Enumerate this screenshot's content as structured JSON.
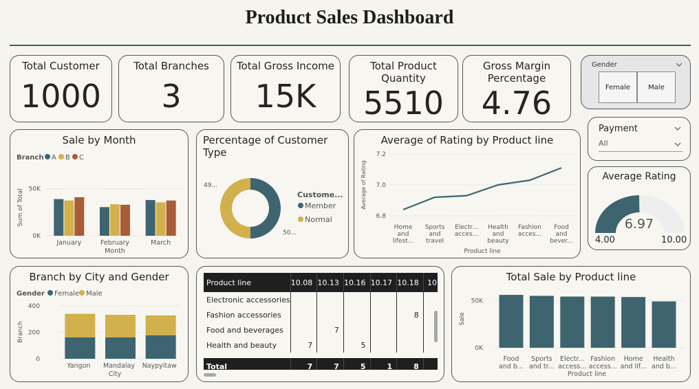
{
  "dashboard": {
    "title": "Product Sales Dashboard"
  },
  "kpis": [
    {
      "label": "Total Customer",
      "value": "1000"
    },
    {
      "label": "Total Branches",
      "value": "3"
    },
    {
      "label": "Total Gross Income",
      "value": "15K"
    },
    {
      "label": "Total Product Quantity",
      "value": "5510"
    },
    {
      "label": "Gross Margin Percentage",
      "value": "4.76"
    }
  ],
  "gender_slicer": {
    "title": "Gender",
    "options": [
      "Female",
      "Male"
    ],
    "chevron_icon": "chevron-down-icon"
  },
  "payment_slicer": {
    "title": "Payment",
    "value": "All",
    "chevron_icon": "chevron-down-icon"
  },
  "avg_rating": {
    "title": "Average Rating",
    "value": "6.97",
    "min": "4.00",
    "max": "10.00"
  },
  "colors": {
    "teal": "#3e6470",
    "gold": "#d2b04c",
    "rust": "#a95c38",
    "track": "#eeeeee"
  },
  "chart_data": [
    {
      "id": "sale_by_month",
      "type": "bar",
      "title": "Sale by Month",
      "legend_title": "Branch",
      "categories": [
        "January",
        "February",
        "March"
      ],
      "series": [
        {
          "name": "A",
          "values": [
            39000,
            30500,
            38000
          ]
        },
        {
          "name": "B",
          "values": [
            37500,
            33500,
            35500
          ]
        },
        {
          "name": "C",
          "values": [
            41000,
            33000,
            37500
          ]
        }
      ],
      "xlabel": "Month",
      "ylabel": "Sum of Total",
      "yticks": [
        "0K",
        "50K"
      ],
      "ylim": [
        0,
        60000
      ]
    },
    {
      "id": "customer_type",
      "type": "pie",
      "title": "Percentage of Customer Type",
      "legend_title": "Custome...",
      "categories": [
        "Member",
        "Normal"
      ],
      "values": [
        50.1,
        49.9
      ],
      "data_labels": [
        "50...",
        "49..."
      ]
    },
    {
      "id": "rating_by_product_line",
      "type": "line",
      "title": "Average of Rating by Product line",
      "categories": [
        "Home and lifest...",
        "Sports and travel",
        "Electr... acces...",
        "Health and beauty",
        "Fashion acces...",
        "Food and bever..."
      ],
      "values": [
        6.84,
        6.92,
        6.93,
        7.0,
        7.03,
        7.11
      ],
      "xlabel": "Product line",
      "ylabel": "Average of Rating",
      "yticks": [
        "6.8",
        "7.0",
        "7.2"
      ],
      "ylim": [
        6.8,
        7.2
      ]
    },
    {
      "id": "branch_by_city_gender",
      "type": "bar",
      "title": "Branch by City and Gender",
      "legend_title": "Gender",
      "categories": [
        "Yangon",
        "Mandalay",
        "Naypyitaw"
      ],
      "series": [
        {
          "name": "Female",
          "values": [
            161,
            162,
            178
          ]
        },
        {
          "name": "Male",
          "values": [
            179,
            170,
            150
          ]
        }
      ],
      "xlabel": "City",
      "ylabel": "Branch",
      "yticks": [
        "0",
        "200",
        "400"
      ],
      "ylim": [
        0,
        400
      ]
    },
    {
      "id": "product_line_matrix",
      "type": "table",
      "row_header": "Product line",
      "columns": [
        "10.08",
        "10.13",
        "10.16",
        "10.17",
        "10.18",
        "10"
      ],
      "rows": [
        {
          "label": "Electronic accessories",
          "cells": [
            "",
            "",
            "",
            "",
            "",
            ""
          ]
        },
        {
          "label": "Fashion accessories",
          "cells": [
            "",
            "",
            "",
            "",
            "8",
            ""
          ]
        },
        {
          "label": "Food and beverages",
          "cells": [
            "",
            "7",
            "",
            "",
            "",
            ""
          ]
        },
        {
          "label": "Health and beauty",
          "cells": [
            "7",
            "",
            "5",
            "",
            "",
            ""
          ]
        }
      ],
      "total": {
        "label": "Total",
        "cells": [
          "7",
          "7",
          "5",
          "1",
          "8",
          ""
        ]
      }
    },
    {
      "id": "total_sale_by_product_line",
      "type": "bar",
      "title": "Total Sale by Product line",
      "categories": [
        "Food and b...",
        "Sports and tr...",
        "Electr... access...",
        "Fashion access...",
        "Home and lif...",
        "Health and b..."
      ],
      "values": [
        56145,
        55123,
        54338,
        54306,
        53862,
        49193
      ],
      "xlabel": "Product line",
      "ylabel": "Sale",
      "yticks": [
        "0K",
        "50K"
      ],
      "ylim": [
        0,
        62000
      ]
    }
  ]
}
